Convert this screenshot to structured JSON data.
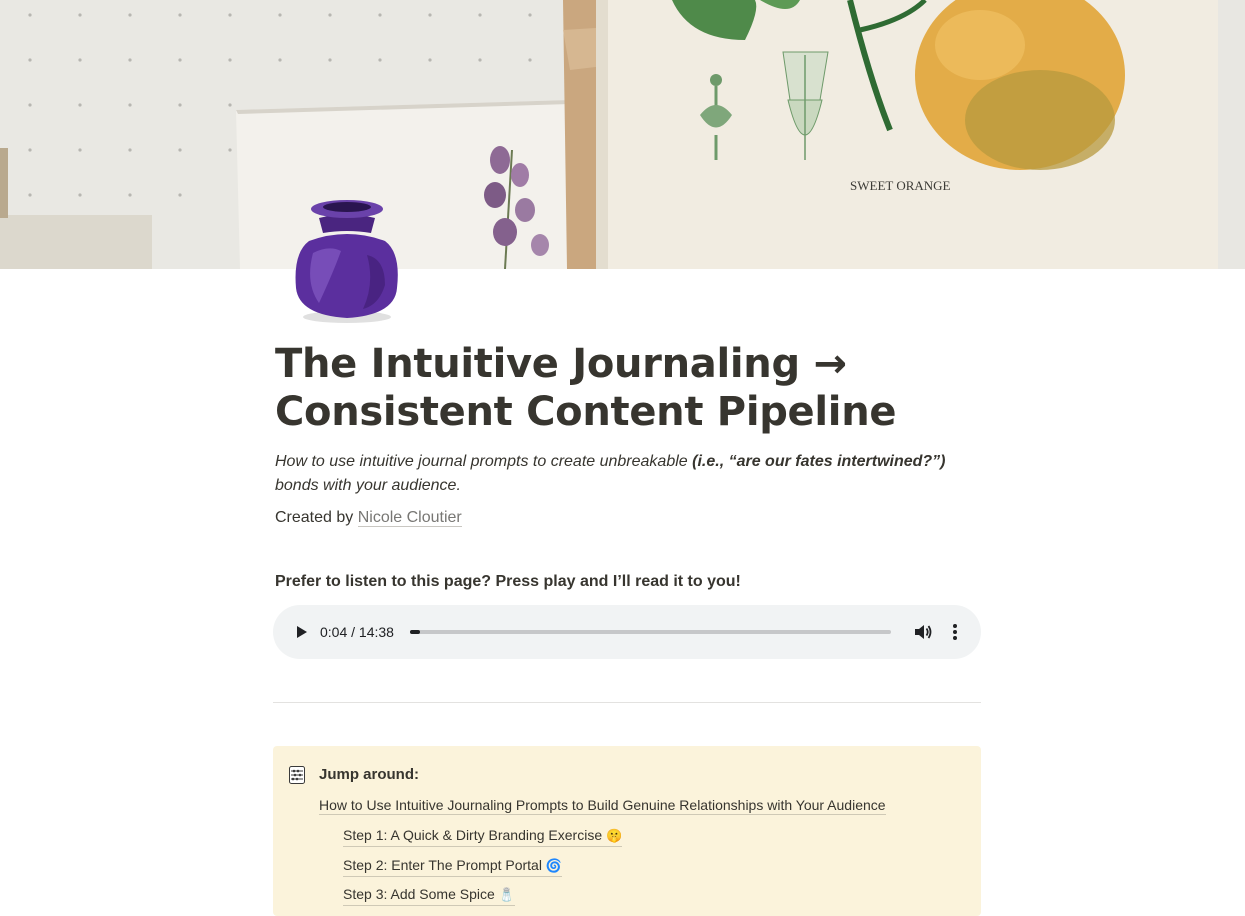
{
  "cover": {
    "label_text": "SWEET ORANGE"
  },
  "page": {
    "title": "The Intuitive Journaling → Consistent Content Pipeline",
    "subtitle_start": "How to use intuitive journal prompts to create unbreakable ",
    "subtitle_bold": "(i.e., “are our fates intertwined?”)",
    "subtitle_end": " bonds with your audience.",
    "created_by_label": "Created by ",
    "author": "Nicole Cloutier",
    "listen_prompt": "Prefer to listen to this page? Press play and I’ll read it to you!"
  },
  "audio": {
    "time": "0:04 / 14:38",
    "progress": 0.0046,
    "icons": [
      "play-icon",
      "volume-icon",
      "more-vert-icon"
    ]
  },
  "toc": {
    "title": "Jump around:",
    "icon": "abacus-icon",
    "items": [
      {
        "label": "How to Use Intuitive Journaling Prompts to Build Genuine Relationships with Your Audience",
        "emoji": ""
      },
      {
        "label": "Step 1: A Quick & Dirty Branding Exercise",
        "emoji": "🤫"
      },
      {
        "label": "Step 2: Enter The Prompt Portal",
        "emoji": "🌀"
      },
      {
        "label": "Step 3: Add Some Spice",
        "emoji": "🧂"
      }
    ]
  },
  "colors": {
    "text": "#37352f",
    "muted": "#787774",
    "callout_bg": "#fbf3db",
    "player_bg": "#f1f3f4",
    "bottle_purple": "#5b2f9e"
  }
}
